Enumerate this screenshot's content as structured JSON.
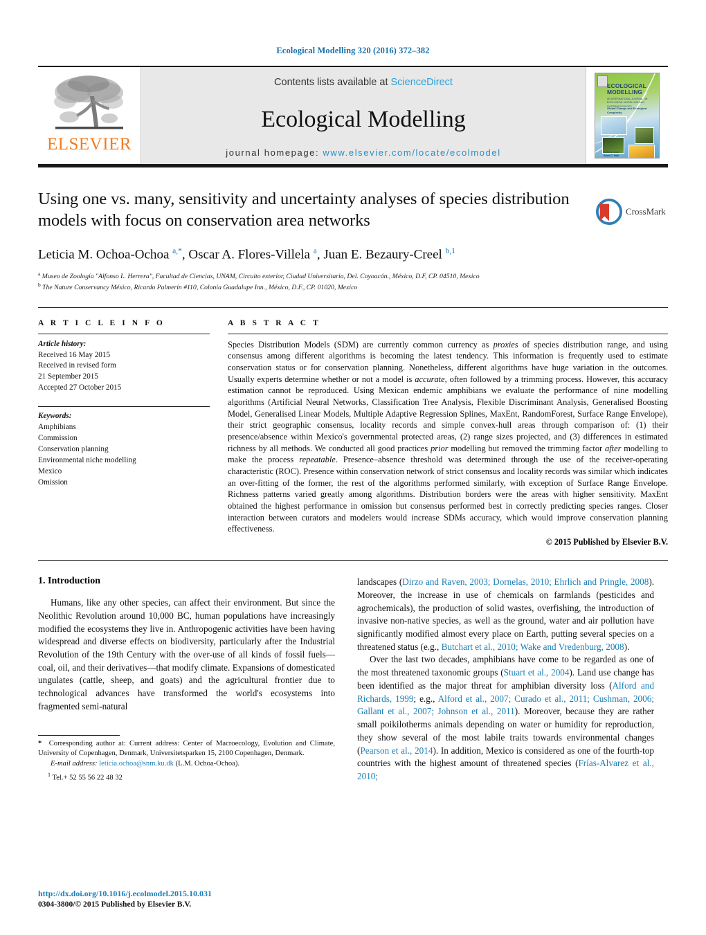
{
  "journal_ref": "Ecological Modelling 320 (2016) 372–382",
  "masthead": {
    "publisher_wordmark": "ELSEVIER",
    "contents_prefix": "Contents lists available at ",
    "contents_link": "ScienceDirect",
    "journal_title": "Ecological Modelling",
    "homepage_prefix": "journal homepage: ",
    "homepage_url": "www.elsevier.com/locate/ecolmodel",
    "cover": {
      "title_line1": "ECOLOGICAL",
      "title_line2": "MODELLING",
      "subtitle": "AN INTERNATIONAL JOURNAL ON ECOLOGICAL MODELLING AND SYSTEMS ECOLOGY",
      "section": "Global Change and Ecological Complexity",
      "editor_label": "Editor-in-Chief",
      "editor_name": "Brian D. Fath"
    }
  },
  "crossmark": {
    "label": "CrossMark"
  },
  "article": {
    "title": "Using one vs. many, sensitivity and uncertainty analyses of species distribution models with focus on conservation area networks",
    "authors_html": "Leticia M. Ochoa-Ochoa <sup>a,*</sup>, Oscar A. Flores-Villela <sup>a</sup>, Juan E. Bezaury-Creel <sup>b,1</sup>",
    "affiliation_a": "Museo de Zoología \"Alfonso L. Herrera\", Facultad de Ciencias, UNAM, Circuito exterior, Ciudad Universitaria, Del. Coyoacán., México, D.F, CP. 04510, Mexico",
    "affiliation_b": "The Nature Conservancy México, Ricardo Palmerín #110, Colonia Guadalupe Inn., México, D.F., CP. 01020, Mexico"
  },
  "article_info": {
    "heading": "A R T I C L E   I N F O",
    "history_label": "Article history:",
    "history": [
      "Received 16 May 2015",
      "Received in revised form",
      "21 September 2015",
      "Accepted 27 October 2015"
    ],
    "keywords_label": "Keywords:",
    "keywords": [
      "Amphibians",
      "Commission",
      "Conservation planning",
      "Environmental niche modelling",
      "Mexico",
      "Omission"
    ]
  },
  "abstract": {
    "heading": "A B S T R A C T",
    "text_html": "Species Distribution Models (SDM) are currently common currency as <i>proxies</i> of species distribution range, and using consensus among different algorithms is becoming the latest tendency. This information is frequently used to estimate conservation status or for conservation planning. Nonetheless, different algorithms have huge variation in the outcomes. Usually experts determine whether or not a model is <i>accurate</i>, often followed by a trimming process. However, this accuracy estimation cannot be reproduced. Using Mexican endemic amphibians we evaluate the performance of nine modelling algorithms (Artificial Neural Networks, Classification Tree Analysis, Flexible Discriminant Analysis, Generalised Boosting Model, Generalised Linear Models, Multiple Adaptive Regression Splines, MaxEnt, RandomForest, Surface Range Envelope), their strict geographic consensus, locality records and simple convex-hull areas through comparison of: (1) their presence/absence within Mexico's governmental protected areas, (2) range sizes projected, and (3) differences in estimated richness by all methods. We conducted all good practices <i>prior</i> modelling but removed the trimming factor <i>after</i> modelling to make the process <i>repeatable</i>. Presence–absence threshold was determined through the use of the receiver-operating characteristic (ROC). Presence within conservation network of strict consensus and locality records was similar which indicates an over-fitting of the former, the rest of the algorithms performed similarly, with exception of Surface Range Envelope. Richness patterns varied greatly among algorithms. Distribution borders were the areas with higher sensitivity. MaxEnt obtained the highest performance in omission but consensus performed best in correctly predicting species ranges. Closer interaction between curators and modelers would increase SDMs accuracy, which would improve conservation planning effectiveness.",
    "copyright": "© 2015 Published by Elsevier B.V."
  },
  "introduction": {
    "heading": "1. Introduction",
    "para1_html": "Humans, like any other species, can affect their environment. But since the Neolithic Revolution around 10,000 BC, human populations have increasingly modified the ecosystems they live in. Anthropogenic activities have been having widespread and diverse effects on biodiversity, particularly after the Industrial Revolution of the 19th Century with the over-use of all kinds of fossil fuels—coal, oil, and their derivatives—that modify climate. Expansions of domesticated ungulates (cattle, sheep, and goats) and the agricultural frontier due to technological advances have transformed the world's ecosystems into fragmented semi-natural landscapes (<span class=\"cit\">Dirzo and Raven, 2003; Dornelas, 2010; Ehrlich and Pringle, 2008</span>). Moreover, the increase in use of chemicals on farmlands (pesticides and agrochemicals), the production of solid wastes, overfishing, the introduction of invasive non-native species, as well as the ground, water and air pollution have significantly modified almost every place on Earth, putting several species on a threatened status (e.g., <span class=\"cit\">Butchart et al., 2010; Wake and Vredenburg, 2008</span>).",
    "para2_html": "Over the last two decades, amphibians have come to be regarded as one of the most threatened taxonomic groups (<span class=\"cit\">Stuart et al., 2004</span>). Land use change has been identified as the major threat for amphibian diversity loss (<span class=\"cit\">Alford and Richards, 1999</span>; e.g., <span class=\"cit\">Alford et al., 2007; Curado et al., 2011; Cushman, 2006; Gallant et al., 2007; Johnson et al., 2011</span>). Moreover, because they are rather small poikilotherms animals depending on water or humidity for reproduction, they show several of the most labile traits towards environmental changes (<span class=\"cit\">Pearson et al., 2014</span>). In addition, Mexico is considered as one of the fourth-top countries with the highest amount of threatened species (<span class=\"cit\">Frías-Alvarez et al., 2010;</span>"
  },
  "footnotes": {
    "corresponding_html": "<b>*</b> &nbsp;Corresponding author at: Current address: Center of Macroecology, Evolution and Climate, University of Copenhagen, Denmark, Universitetsparken 15, 2100 Copenhagen, Denmark.",
    "email_label": "E-mail address:",
    "email": "leticia.ochoa@snm.ku.dk",
    "email_suffix": "(L.M. Ochoa-Ochoa).",
    "tel_marker": "1",
    "tel": "Tel.+ 52 55 56 22 48 32"
  },
  "footer": {
    "doi": "http://dx.doi.org/10.1016/j.ecolmodel.2015.10.031",
    "issn_line": "0304-3800/© 2015 Published by Elsevier B.V."
  },
  "colors": {
    "link_blue": "#1a7db5",
    "sciencedirect_blue": "#2a9fd6",
    "elsevier_orange": "#f47b20"
  }
}
